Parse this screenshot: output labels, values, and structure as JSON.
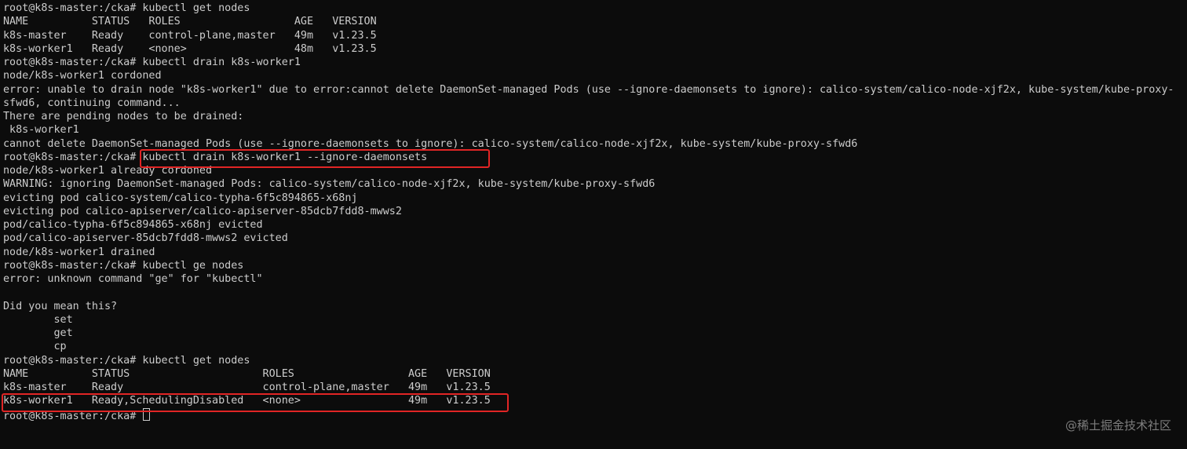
{
  "terminal": {
    "prompt": "root@k8s-master:/cka#",
    "lines": [
      "root@k8s-master:/cka# kubectl get nodes",
      "NAME          STATUS   ROLES                  AGE   VERSION",
      "k8s-master    Ready    control-plane,master   49m   v1.23.5",
      "k8s-worker1   Ready    <none>                 48m   v1.23.5",
      "root@k8s-master:/cka# kubectl drain k8s-worker1",
      "node/k8s-worker1 cordoned",
      "error: unable to drain node \"k8s-worker1\" due to error:cannot delete DaemonSet-managed Pods (use --ignore-daemonsets to ignore): calico-system/calico-node-xjf2x, kube-system/kube-proxy-",
      "sfwd6, continuing command...",
      "There are pending nodes to be drained:",
      " k8s-worker1",
      "cannot delete DaemonSet-managed Pods (use --ignore-daemonsets to ignore): calico-system/calico-node-xjf2x, kube-system/kube-proxy-sfwd6",
      "root@k8s-master:/cka# kubectl drain k8s-worker1 --ignore-daemonsets",
      "node/k8s-worker1 already cordoned",
      "WARNING: ignoring DaemonSet-managed Pods: calico-system/calico-node-xjf2x, kube-system/kube-proxy-sfwd6",
      "evicting pod calico-system/calico-typha-6f5c894865-x68nj",
      "evicting pod calico-apiserver/calico-apiserver-85dcb7fdd8-mwws2",
      "pod/calico-typha-6f5c894865-x68nj evicted",
      "pod/calico-apiserver-85dcb7fdd8-mwws2 evicted",
      "node/k8s-worker1 drained",
      "root@k8s-master:/cka# kubectl ge nodes",
      "error: unknown command \"ge\" for \"kubectl\"",
      "",
      "Did you mean this?",
      "        set",
      "        get",
      "        cp",
      "root@k8s-master:/cka# kubectl get nodes",
      "NAME          STATUS                     ROLES                  AGE   VERSION",
      "k8s-master    Ready                      control-plane,master   49m   v1.23.5",
      "k8s-worker1   Ready,SchedulingDisabled   <none>                 49m   v1.23.5"
    ],
    "last_prompt": "root@k8s-master:/cka# "
  },
  "watermark": "@稀土掘金技术社区",
  "colors": {
    "background": "#0c0c0c",
    "text": "#cccccc",
    "highlight": "#e12525"
  }
}
